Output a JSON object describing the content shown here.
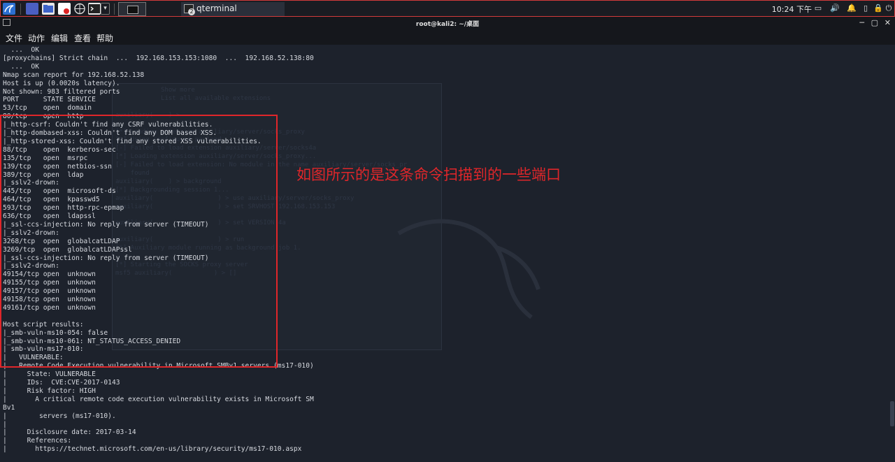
{
  "taskbar": {
    "task_label": "qterminal",
    "task_badge": "2",
    "clock": "10:24 下午",
    "colors": {
      "bg": "#1a1c22",
      "border": "#d23b3b"
    },
    "icons": [
      "kali-menu-icon",
      "desktop-icon",
      "file-manager-icon",
      "text-editor-icon",
      "browser-icon",
      "terminal-icon",
      "dropdown-icon",
      "window-switch-icon"
    ],
    "tray_icons": [
      "display-icon",
      "volume-icon",
      "notification-icon",
      "battery-icon",
      "lock-icon",
      "power-icon"
    ]
  },
  "window": {
    "title": "root@kali2: ~/桌面"
  },
  "menubar": {
    "items": [
      "文件",
      "动作",
      "编辑",
      "查看",
      "帮助"
    ]
  },
  "terminal_lines": [
    "  ...  OK",
    "[proxychains] Strict chain  ...  192.168.153.153:1080  ...  192.168.52.138:80",
    "  ...  OK",
    "Nmap scan report for 192.168.52.138",
    "Host is up (0.0020s latency).",
    "Not shown: 983 filtered ports",
    "PORT      STATE SERVICE",
    "53/tcp    open  domain",
    "80/tcp    open  http",
    "|_http-csrf: Couldn't find any CSRF vulnerabilities.",
    "|_http-dombased-xss: Couldn't find any DOM based XSS.",
    "|_http-stored-xss: Couldn't find any stored XSS vulnerabilities.",
    "88/tcp    open  kerberos-sec",
    "135/tcp   open  msrpc",
    "139/tcp   open  netbios-ssn",
    "389/tcp   open  ldap",
    "|_sslv2-drown:",
    "445/tcp   open  microsoft-ds",
    "464/tcp   open  kpasswd5",
    "593/tcp   open  http-rpc-epmap",
    "636/tcp   open  ldapssl",
    "|_ssl-ccs-injection: No reply from server (TIMEOUT)",
    "|_sslv2-drown:",
    "3268/tcp  open  globalcatLDAP",
    "3269/tcp  open  globalcatLDAPssl",
    "|_ssl-ccs-injection: No reply from server (TIMEOUT)",
    "|_sslv2-drown:",
    "49154/tcp open  unknown",
    "49155/tcp open  unknown",
    "49157/tcp open  unknown",
    "49158/tcp open  unknown",
    "49161/tcp open  unknown",
    "",
    "Host script results:",
    "|_smb-vuln-ms10-054: false",
    "|_smb-vuln-ms10-061: NT_STATUS_ACCESS_DENIED",
    "| smb-vuln-ms17-010:",
    "|   VULNERABLE:",
    "|   Remote Code Execution vulnerability in Microsoft SMBv1 servers (ms17-010)",
    "|     State: VULNERABLE",
    "|     IDs:  CVE:CVE-2017-0143",
    "|     Risk factor: HIGH",
    "|       A critical remote code execution vulnerability exists in Microsoft SM",
    "Bv1",
    "|        servers (ms17-010).",
    "|",
    "|     Disclosure date: 2017-03-14",
    "|     References:",
    "|       https://technet.microsoft.com/en-us/library/security/ms17-010.aspx"
  ],
  "ghost_lines": [
    "            Show more",
    "            List all available extensions",
    "",
    "auxiliary(    ) >",
    "",
    "[*] Loading extension auxiliary/server/socks_proxy",
    "[*] Using configured payload...",
    "[-] Failed to load extension auxiliary/server/socks4a",
    "[*] Loading extension auxiliary/server/socks_proxy...",
    "[-] Failed to load extension: No module in the name auxiliary/server/socks_pr",
    "    found",
    "auxiliary(    ) > background",
    "[*] Backgrounding session 1...",
    "auxiliary(                 ) > use auxiliary/server/socks_proxy",
    "auxiliary(                 ) > set SRVHOST 192.168.153.153",
    "",
    "auxiliary(                 ) > set VERSION 4a",
    "",
    "auxiliary(                 ) > run",
    "[*] Auxiliary module running as background job 1.",
    "",
    "[*] Starting the SOCKS proxy server",
    "msf5 auxiliary(           ) > []"
  ],
  "annotation": {
    "text": "如图所示的是这条命令扫描到的一些端口",
    "color": "#e0262a"
  }
}
